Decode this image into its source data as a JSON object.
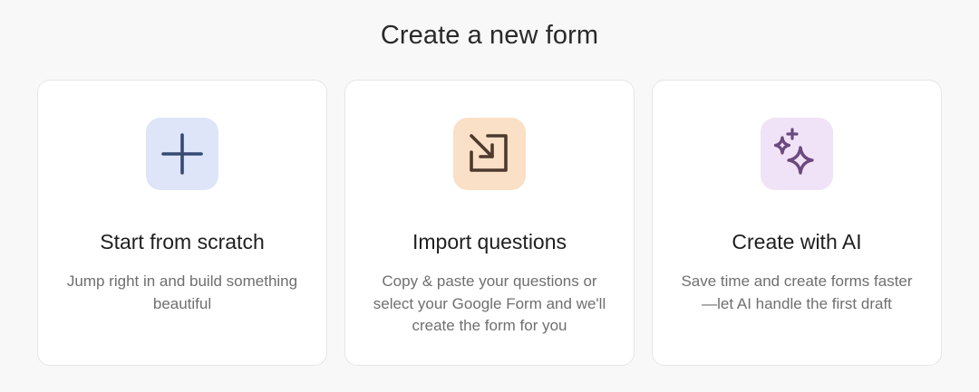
{
  "page": {
    "title": "Create a new form"
  },
  "options": [
    {
      "title": "Start from scratch",
      "description": "Jump right in and build something beautiful",
      "icon": "plus-icon",
      "tile_color": "#dee5f8",
      "icon_color": "#354a72"
    },
    {
      "title": "Import questions",
      "description": "Copy & paste your questions or select your Google Form and we'll create the form for you",
      "icon": "import-arrow-icon",
      "tile_color": "#fae0c6",
      "icon_color": "#4e3a2c"
    },
    {
      "title": "Create with AI",
      "description": "Save time and create forms faster—let AI handle the first draft",
      "icon": "sparkles-icon",
      "tile_color": "#f1e3f7",
      "icon_color": "#6b4a80"
    }
  ]
}
